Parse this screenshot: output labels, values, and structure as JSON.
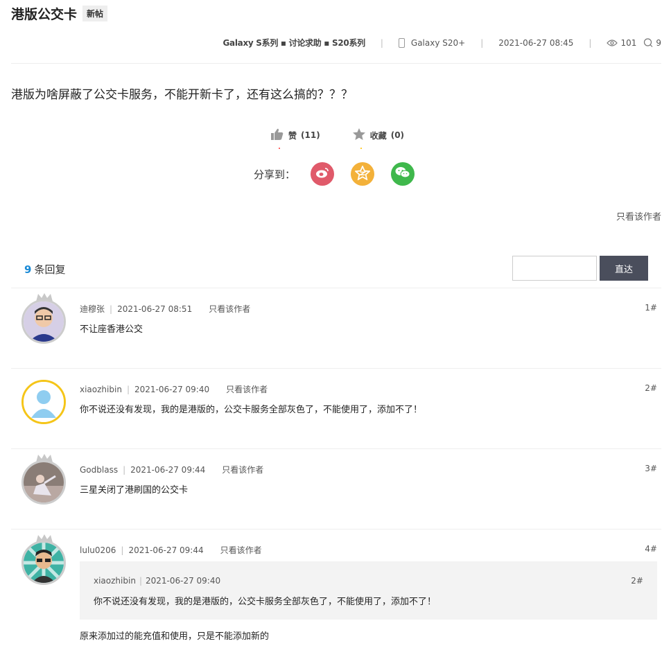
{
  "post": {
    "title": "港版公交卡",
    "badge": "新帖",
    "breadcrumb": "Galaxy S系列 ▪ 讨论求助 ▪ S20系列",
    "device": "Galaxy S20+",
    "datetime": "2021-06-27 08:45",
    "views": "101",
    "replies_count": "9",
    "body": "港版为啥屏蔽了公交卡服务，不能开新卡了，还有这么搞的？？？"
  },
  "actions": {
    "like_label": "赞",
    "like_count": "(11)",
    "fav_label": "收藏",
    "fav_count": "(0)",
    "share_label": "分享到：",
    "share_icons": [
      "weibo-icon",
      "qzone-icon",
      "wechat-icon"
    ],
    "colors": {
      "weibo": "#e05a6a",
      "qzone": "#f3b13a",
      "wechat": "#3fb84c"
    }
  },
  "only_author": "只看该作者",
  "reply_header": {
    "count": "9",
    "label": "条回复",
    "goto_label": "直达"
  },
  "replies": [
    {
      "user": "迪穆张",
      "time": "2021-06-27 08:51",
      "only_author": "只看该作者",
      "floor": "1#",
      "text": "不让座香港公交"
    },
    {
      "user": "xiaozhibin",
      "time": "2021-06-27 09:40",
      "only_author": "只看该作者",
      "floor": "2#",
      "text": "你不说还没有发现，我的是港版的，公交卡服务全部灰色了，不能使用了，添加不了！"
    },
    {
      "user": "Godblass",
      "time": "2021-06-27 09:44",
      "only_author": "只看该作者",
      "floor": "3#",
      "text": "三星关闭了港刷国的公交卡"
    },
    {
      "user": "lulu0206",
      "time": "2021-06-27 09:44",
      "only_author": "只看该作者",
      "floor": "4#",
      "quote": {
        "user": "xiaozhibin",
        "time": "2021-06-27 09:40",
        "floor": "2#",
        "text": "你不说还没有发现，我的是港版的，公交卡服务全部灰色了，不能使用了，添加不了！"
      },
      "text": "原来添加过的能充值和使用，只是不能添加新的"
    }
  ]
}
